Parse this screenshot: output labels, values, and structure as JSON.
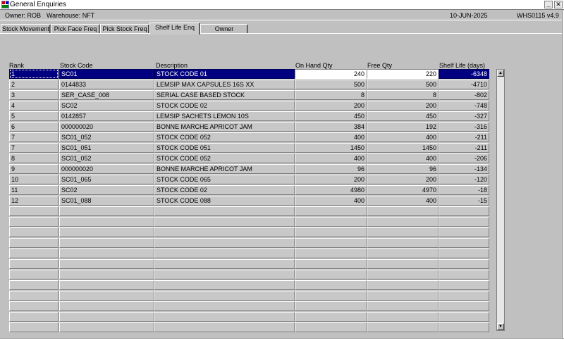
{
  "window": {
    "title": "General Enquiries",
    "minimize_glyph": "_",
    "close_glyph": "✕"
  },
  "info": {
    "owner": "Owner:  ROB",
    "warehouse": "Warehouse:  NFT",
    "date": "10-JUN-2025",
    "version": "WHS0115  v4.9"
  },
  "tabs": [
    {
      "label": "Stock Movement"
    },
    {
      "label": "Pick Face Freq"
    },
    {
      "label": "Pick Stock Freq"
    },
    {
      "label": "Shelf Life Enq"
    },
    {
      "label": "Owner"
    }
  ],
  "active_tab": "Shelf Life Enq",
  "table": {
    "columns": [
      "Rank",
      "Stock Code",
      "Description",
      "On Hand Qty",
      "Free Qty",
      "Shelf Life (days)"
    ],
    "rows": [
      [
        "1",
        "SC01",
        "STOCK CODE 01",
        "240",
        "220",
        "-6348"
      ],
      [
        "2",
        "0144833",
        "LEMSIP MAX CAPSULES 16S XX",
        "500",
        "500",
        "-4710"
      ],
      [
        "3",
        "SER_CASE_008",
        "SERIAL CASE BASED STOCK",
        "8",
        "8",
        "-802"
      ],
      [
        "4",
        "SC02",
        "STOCK CODE 02",
        "200",
        "200",
        "-748"
      ],
      [
        "5",
        "0142857",
        "LEMSIP SACHETS LEMON 10S",
        "450",
        "450",
        "-327"
      ],
      [
        "6",
        "000000020",
        "BONNE MARCHE APRICOT JAM",
        "384",
        "192",
        "-316"
      ],
      [
        "7",
        "SC01_052",
        "STOCK CODE 052",
        "400",
        "400",
        "-211"
      ],
      [
        "7",
        "SC01_051",
        "STOCK CODE 051",
        "1450",
        "1450",
        "-211"
      ],
      [
        "8",
        "SC01_052",
        "STOCK CODE 052",
        "400",
        "400",
        "-206"
      ],
      [
        "9",
        "000000020",
        "BONNE MARCHE APRICOT JAM",
        "96",
        "96",
        "-134"
      ],
      [
        "10",
        "SC01_065",
        "STOCK CODE 065",
        "200",
        "200",
        "-120"
      ],
      [
        "11",
        "SC02",
        "STOCK CODE 02",
        "4980",
        "4970",
        "-18"
      ],
      [
        "12",
        "SC01_088",
        "STOCK CODE 088",
        "400",
        "400",
        "-15"
      ]
    ],
    "selected_row": 1,
    "empty_rows": 12
  },
  "scrollbar": {
    "up_glyph": "▲",
    "down_glyph": "▼"
  }
}
